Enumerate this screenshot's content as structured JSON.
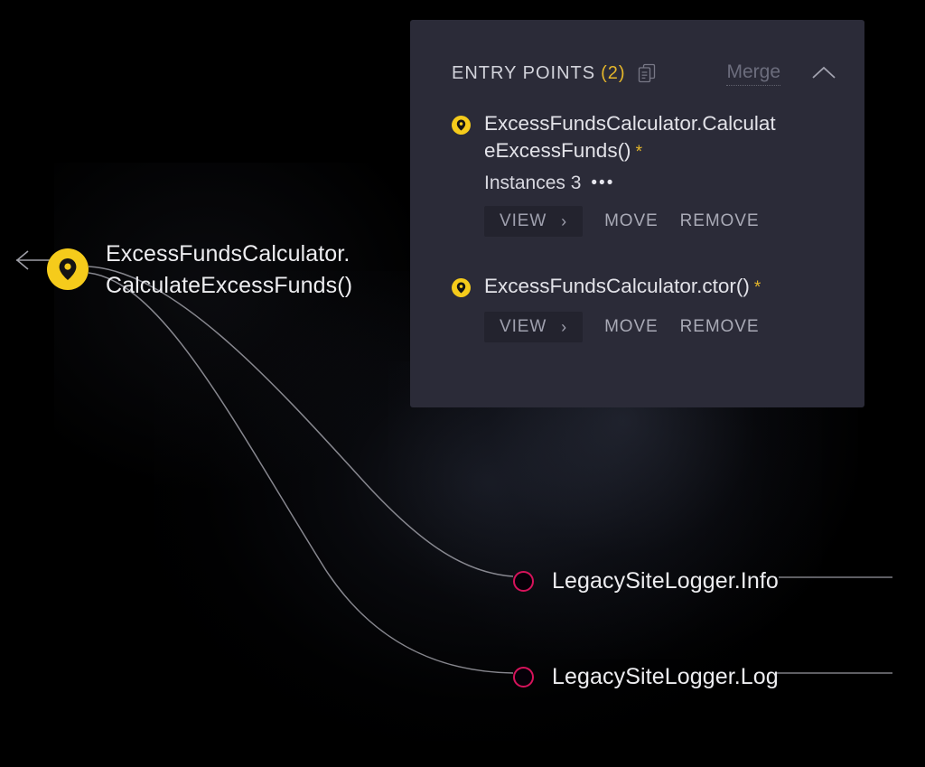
{
  "canvas": {
    "background_color": "#000000",
    "accent_yellow": "#F5CB1B",
    "accent_pink": "#D6135B",
    "edge_color": "#9E9EA6"
  },
  "graph": {
    "nodes": [
      {
        "id": "entry-node",
        "icon": "map-pin-icon",
        "type": "entry-point",
        "label_line1": "ExcessFundsCalculator.",
        "label_line2": "CalculateExcessFunds()",
        "marker_color": "#F5CB1B"
      },
      {
        "id": "legacy-info-node",
        "icon": "ring-node-icon",
        "type": "method",
        "label": "LegacySiteLogger.Info",
        "marker_color": "#D6135B"
      },
      {
        "id": "legacy-log-node",
        "icon": "ring-node-icon",
        "type": "method",
        "label": "LegacySiteLogger.Log",
        "marker_color": "#D6135B"
      }
    ],
    "incoming_arrow": "left-arrow-icon"
  },
  "panel": {
    "title": "ENTRY POINTS",
    "count": "(2)",
    "copy_icon": "copy-icon",
    "merge_label": "Merge",
    "merge_enabled": false,
    "collapse_icon": "chevron-up-icon",
    "background_color": "#2B2B38",
    "entries": [
      {
        "icon": "map-pin-icon",
        "name": "ExcessFundsCalculator.CalculateExcessFunds()",
        "modified_marker": "*",
        "instances_label": "Instances 3",
        "instances_more": "•••",
        "view_label": "VIEW",
        "view_chevron": "›",
        "move_label": "MOVE",
        "remove_label": "REMOVE"
      },
      {
        "icon": "map-pin-icon",
        "name": "ExcessFundsCalculator.ctor()",
        "modified_marker": "*",
        "instances_label": null,
        "view_label": "VIEW",
        "view_chevron": "›",
        "move_label": "MOVE",
        "remove_label": "REMOVE"
      }
    ]
  }
}
